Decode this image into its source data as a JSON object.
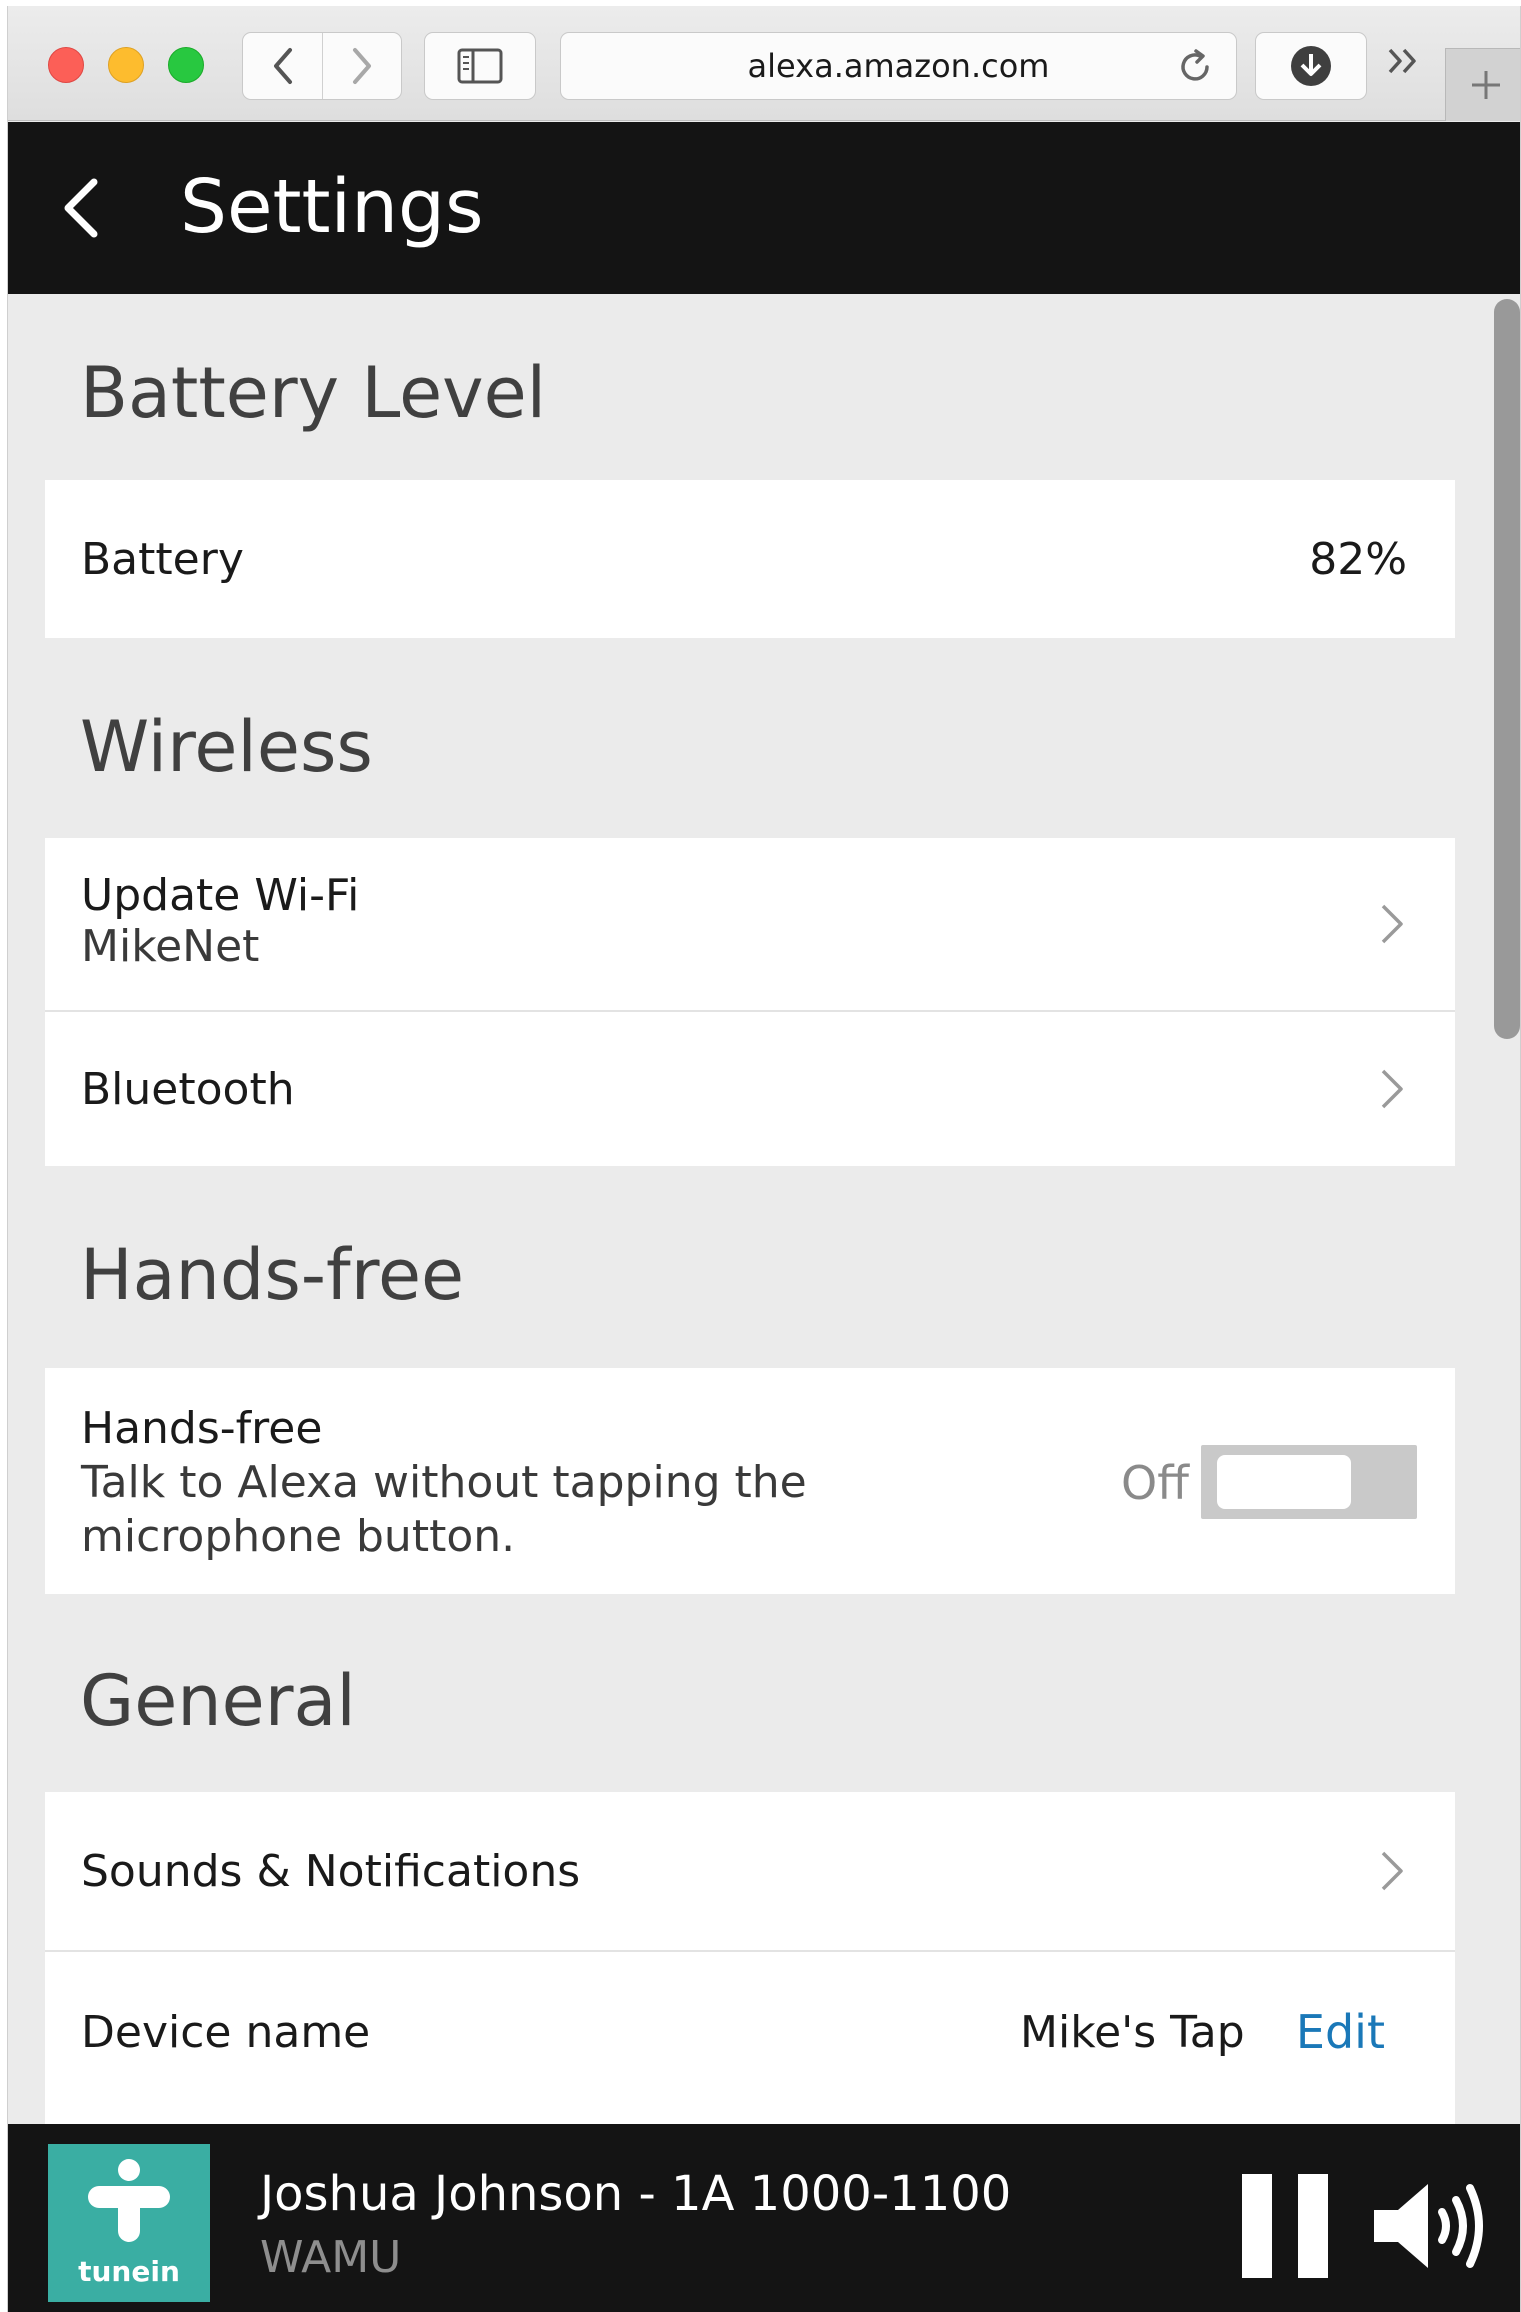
{
  "browser": {
    "url": "alexa.amazon.com",
    "icons": {
      "back": "chevron-left-icon",
      "forward": "chevron-right-icon",
      "sidebar": "sidebar-icon",
      "reload": "reload-icon",
      "download": "download-icon",
      "more": "double-chevron-icon",
      "new_tab": "plus-icon"
    },
    "more_label": "»"
  },
  "header": {
    "title": "Settings"
  },
  "battery": {
    "section_title": "Battery Level",
    "label": "Battery",
    "value": "82%"
  },
  "wireless": {
    "section_title": "Wireless",
    "wifi_label": "Update Wi-Fi",
    "wifi_network": "MikeNet",
    "bluetooth_label": "Bluetooth"
  },
  "handsfree": {
    "section_title": "Hands-free",
    "label": "Hands-free",
    "description_line1": "Talk to Alexa without tapping the",
    "description_line2": "microphone button.",
    "toggle_state": "Off"
  },
  "general": {
    "section_title": "General",
    "sounds_label": "Sounds & Notifications",
    "device_name_label": "Device name",
    "device_name_value": "Mike's Tap",
    "edit_label": "Edit"
  },
  "player": {
    "logo_text": "tunein",
    "track_title": "Joshua Johnson - 1A 1000-1100",
    "station": "WAMU"
  },
  "colors": {
    "header_bg": "#141414",
    "page_bg": "#ebebeb",
    "card_bg": "#ffffff",
    "link": "#1a78b8",
    "tunein": "#3aaea3",
    "toggle_off": "#c9c9c9"
  }
}
